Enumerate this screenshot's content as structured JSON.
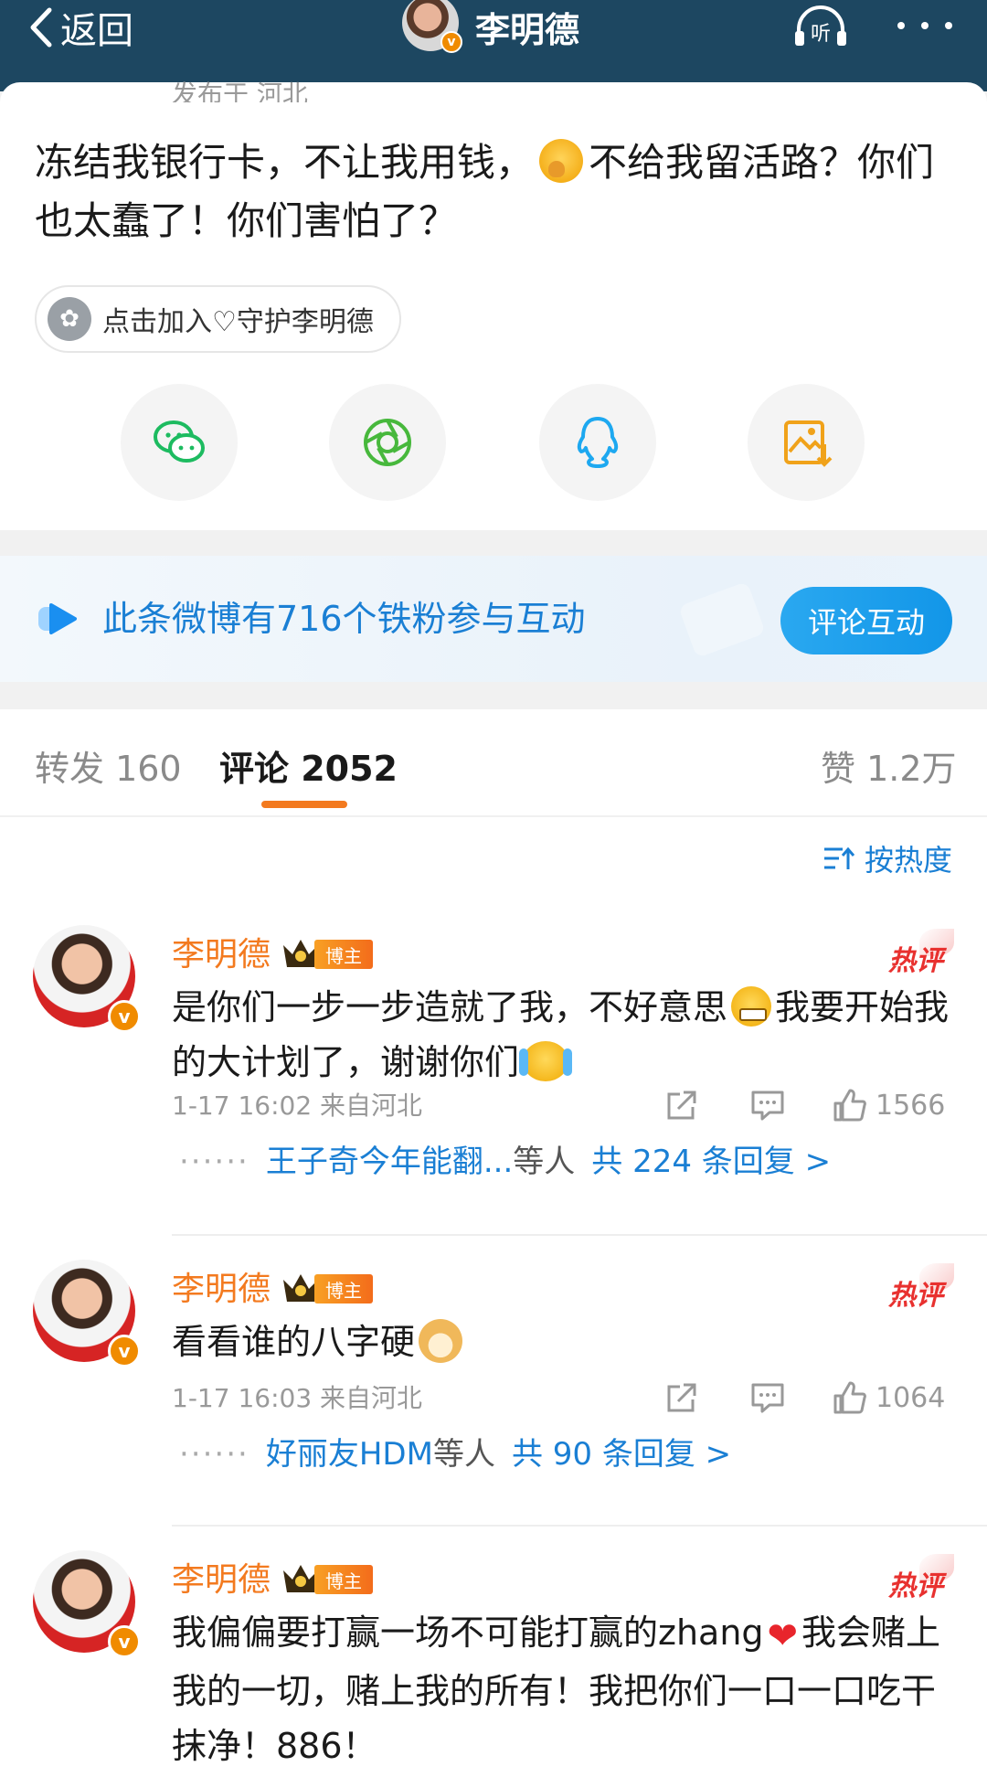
{
  "topbar": {
    "back_label": "返回",
    "title": "李明德",
    "listen_label": "听"
  },
  "post": {
    "meta": "发布于 河北",
    "text_part1": "冻结我银行卡，不让我用钱，",
    "text_part2": "不给我留活路？你们也太蠢了！你们害怕了？",
    "guard_label": "点击加入♡守护李明德"
  },
  "share": {
    "items": [
      "wechat-icon",
      "moments-icon",
      "qq-icon",
      "save-image-icon"
    ],
    "colors": {
      "wechat": "#1dbb60",
      "moments": "#47b83c",
      "qq": "#1da8f0",
      "save": "#f0a21a"
    }
  },
  "fans_banner": {
    "text": "此条微博有716个铁粉参与互动",
    "button": "评论互动"
  },
  "tabs": {
    "repost": "转发 160",
    "comments": "评论 2052",
    "likes": "赞 1.2万"
  },
  "sort": {
    "label": "按热度"
  },
  "comments": [
    {
      "name": "李明德",
      "badge": "博主",
      "hot": "热评",
      "text_a": "是你们一步一步造就了我，不好意思",
      "text_b": "我要开始我的大计划了，谢谢你们",
      "meta": "1-17 16:02  来自河北",
      "likes": "1566",
      "reply_names": "王子奇今年能翻...",
      "reply_etc": "等人",
      "reply_count": "共 224 条回复 >"
    },
    {
      "name": "李明德",
      "badge": "博主",
      "hot": "热评",
      "text_a": "看看谁的八字硬",
      "meta": "1-17 16:03  来自河北",
      "likes": "1064",
      "reply_names": "好丽友HDM",
      "reply_etc": "等人",
      "reply_count": "共 90 条回复 >"
    },
    {
      "name": "李明德",
      "badge": "博主",
      "hot": "热评",
      "text_a": "我偏偏要打赢一场不可能打赢的zhang",
      "text_b": "我会赌上我的一切，赌上我的所有！我把你们一口一口吃干抹净！886！"
    }
  ],
  "colors": {
    "topbar": "#1d4761",
    "accent_orange": "#f37a1f",
    "link_blue": "#1a7fd4",
    "hot_red": "#e8312f"
  }
}
